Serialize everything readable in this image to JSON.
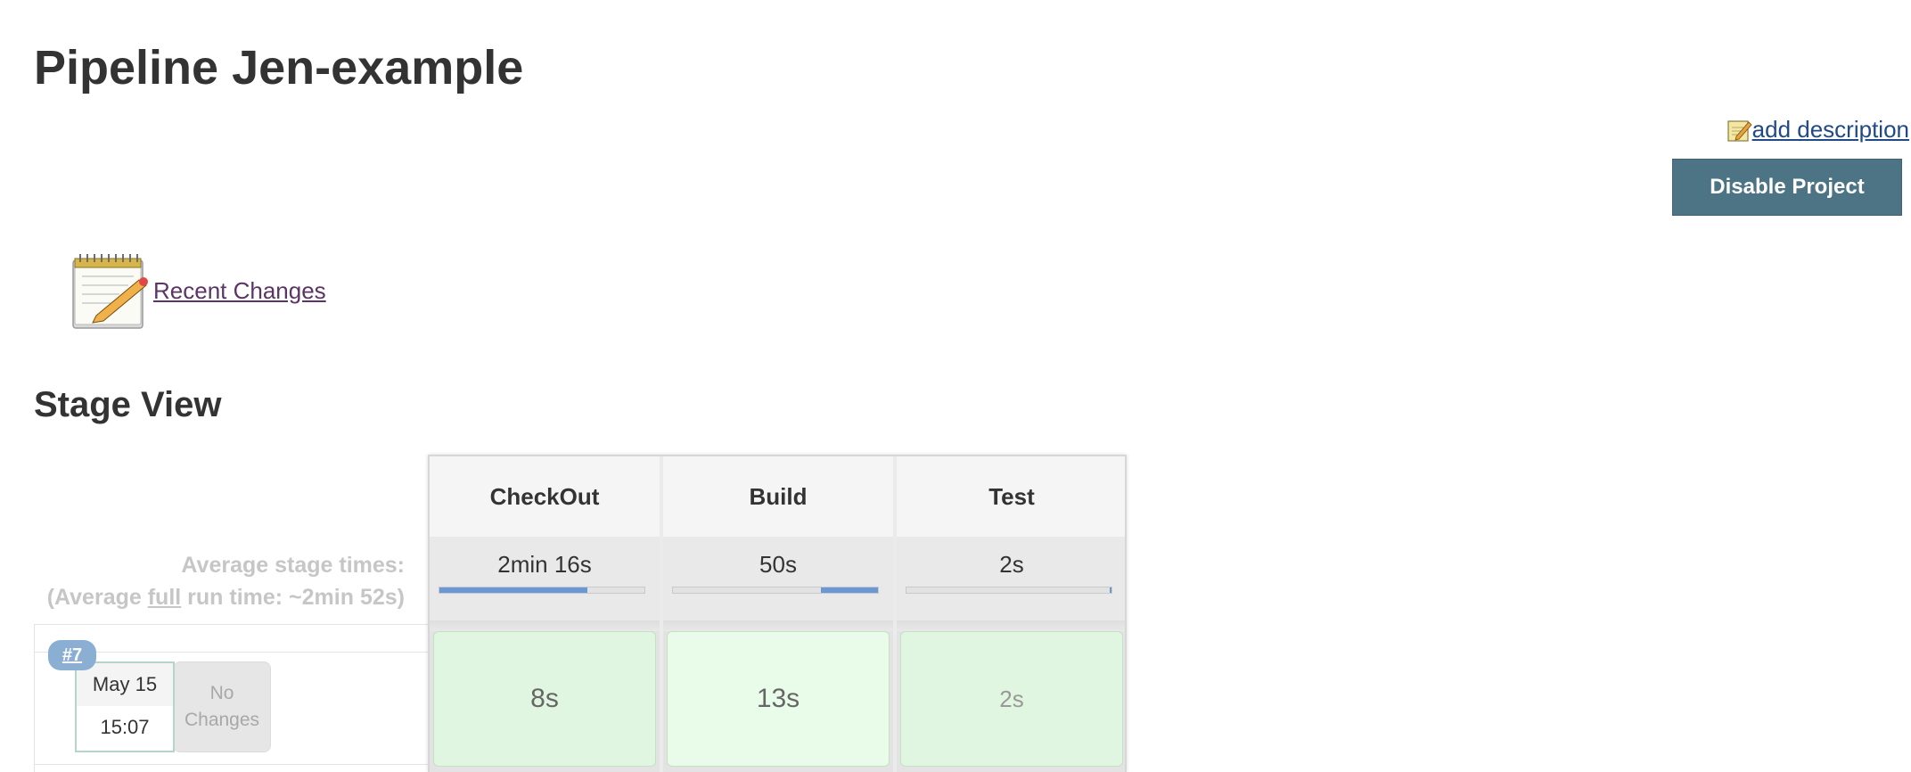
{
  "page": {
    "title": "Pipeline Jen-example"
  },
  "actions": {
    "add_description": "add description",
    "disable_project": "Disable Project"
  },
  "links": {
    "recent_changes": "Recent Changes"
  },
  "stage_view": {
    "title": "Stage View",
    "average_label_line1": "Average stage times:",
    "average_label_prefix": "(Average ",
    "average_label_full": "full",
    "average_label_suffix": " run time: ~2min 52s)",
    "stages": [
      {
        "name": "CheckOut",
        "avg_time": "2min 16s",
        "bar_fill": 0.72,
        "bar_start": 0.0
      },
      {
        "name": "Build",
        "avg_time": "50s",
        "bar_fill": 0.28,
        "bar_start": 0.72
      },
      {
        "name": "Test",
        "avg_time": "2s",
        "bar_fill": 0.01,
        "bar_start": 0.99
      }
    ],
    "builds": [
      {
        "number": "#7",
        "date": "May 15",
        "time": "15:07",
        "changes": "No Changes",
        "stage_times": [
          "8s",
          "13s",
          "2s"
        ]
      }
    ],
    "colors": {
      "success_cell": "#e1f6e1",
      "success_cell_border": "#c2e2c2",
      "bar_fill": "#6a98d6",
      "badge": "#8aafd3"
    }
  }
}
